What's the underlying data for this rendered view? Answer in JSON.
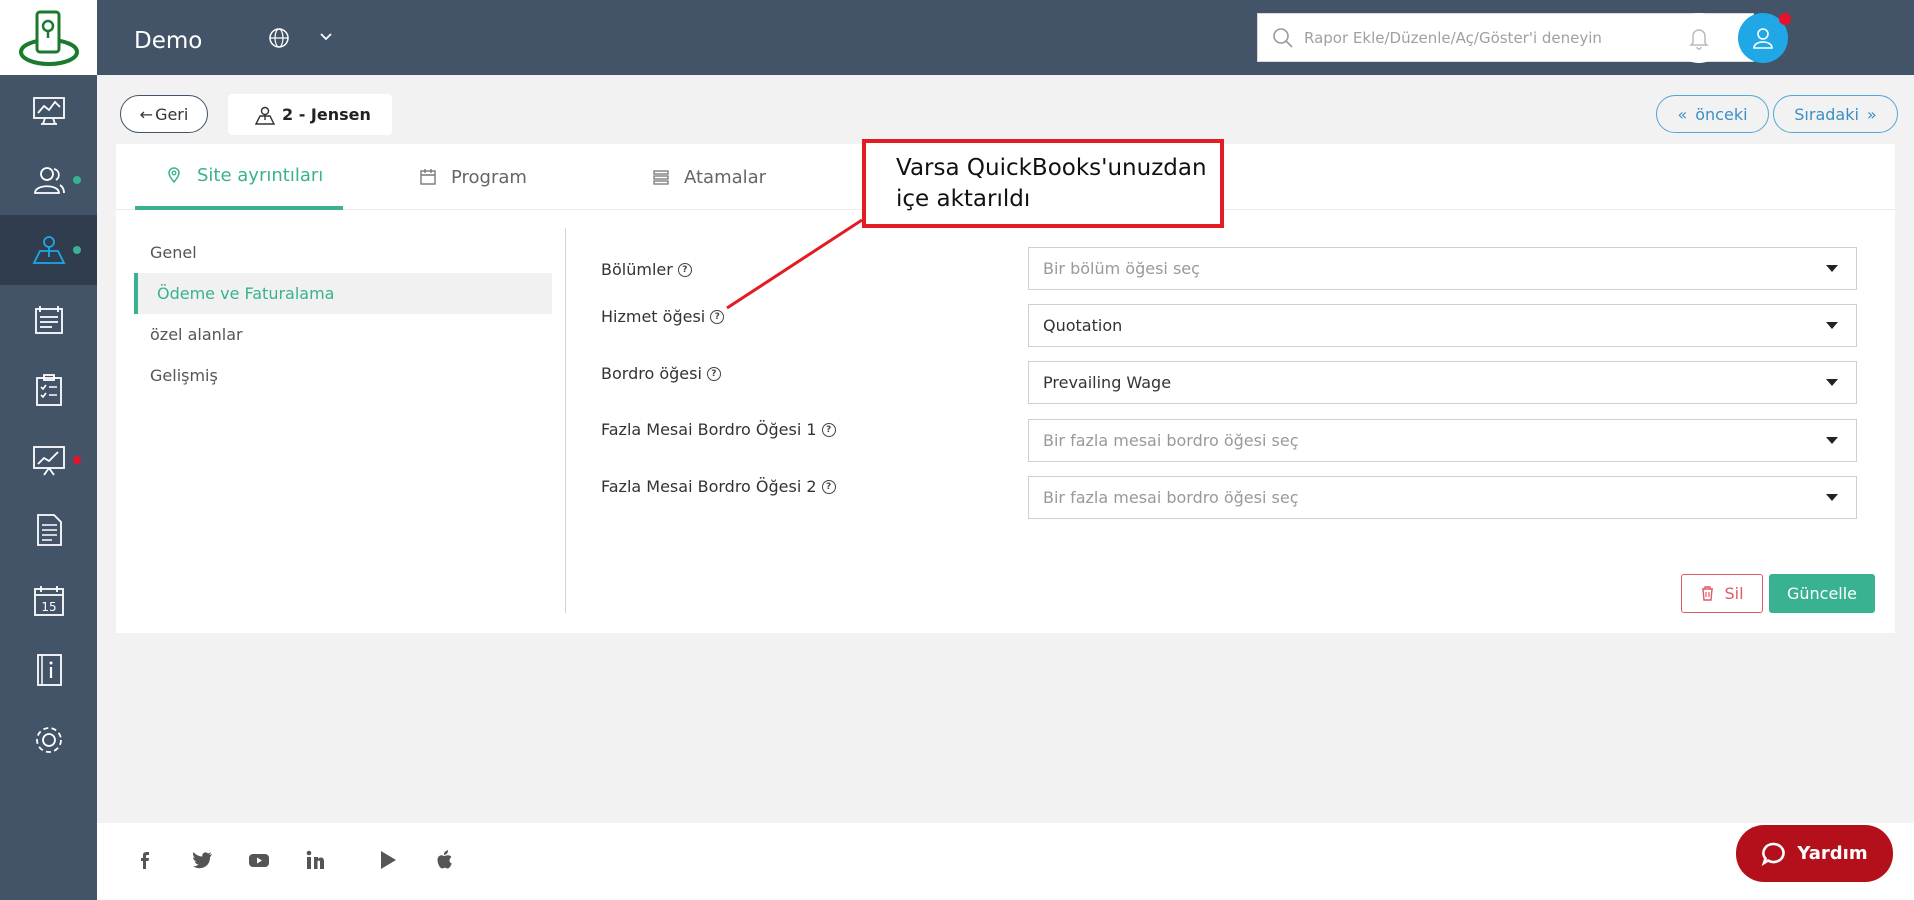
{
  "app": {
    "brand": "Demo"
  },
  "search": {
    "placeholder": "Rapor Ekle/Düzenle/Aç/Göster'i deneyin"
  },
  "header": {
    "back_label": "Geri",
    "site_label": "2 - Jensen",
    "prev_label": "önceki",
    "next_label": "Sıradaki"
  },
  "tabs": [
    {
      "label": "Site ayrıntıları",
      "icon": "map-pin-icon",
      "active": true
    },
    {
      "label": "Program",
      "icon": "calendar-icon",
      "active": false
    },
    {
      "label": "Atamalar",
      "icon": "list-icon",
      "active": false
    }
  ],
  "side_menu": [
    {
      "label": "Genel",
      "active": false
    },
    {
      "label": "Ödeme ve Faturalama",
      "active": true
    },
    {
      "label": "özel alanlar",
      "active": false
    },
    {
      "label": "Gelişmiş",
      "active": false
    }
  ],
  "form": {
    "fields": [
      {
        "label": "Bölümler",
        "value": "",
        "placeholder": "Bir bölüm öğesi seç"
      },
      {
        "label": "Hizmet öğesi",
        "value": "Quotation",
        "placeholder": ""
      },
      {
        "label": "Bordro öğesi",
        "value": "Prevailing Wage",
        "placeholder": ""
      },
      {
        "label": "Fazla Mesai Bordro Öğesi 1",
        "value": "",
        "placeholder": "Bir fazla mesai bordro öğesi seç"
      },
      {
        "label": "Fazla Mesai Bordro Öğesi 2",
        "value": "",
        "placeholder": "Bir fazla mesai bordro öğesi seç"
      }
    ],
    "delete_label": "Sil",
    "update_label": "Güncelle"
  },
  "annotation": {
    "line1": "Varsa QuickBooks'unuzdan",
    "line2": "içe aktarıldı"
  },
  "help": {
    "label": "Yardım"
  },
  "sidebar": {
    "items": [
      {
        "icon": "dashboard-icon",
        "active": false,
        "dot": ""
      },
      {
        "icon": "users-icon",
        "active": false,
        "dot": "#38b290"
      },
      {
        "icon": "sites-map-icon",
        "active": true,
        "dot": "#38b290"
      },
      {
        "icon": "schedule-board-icon",
        "active": false,
        "dot": ""
      },
      {
        "icon": "checklist-icon",
        "active": false,
        "dot": ""
      },
      {
        "icon": "reports-chart-icon",
        "active": false,
        "dot": "#e8112d"
      },
      {
        "icon": "document-icon",
        "active": false,
        "dot": ""
      },
      {
        "icon": "calendar-15-icon",
        "active": false,
        "dot": ""
      },
      {
        "icon": "info-book-icon",
        "active": false,
        "dot": ""
      },
      {
        "icon": "settings-gear-icon",
        "active": false,
        "dot": ""
      }
    ]
  },
  "footer_social": [
    "facebook-icon",
    "twitter-icon",
    "youtube-icon",
    "linkedin-icon",
    "google-play-icon",
    "apple-icon"
  ],
  "colors": {
    "sidebar": "#435468",
    "accent": "#38b290",
    "danger": "#e05a67",
    "help": "#b4101b",
    "annotation": "#e31b23"
  }
}
